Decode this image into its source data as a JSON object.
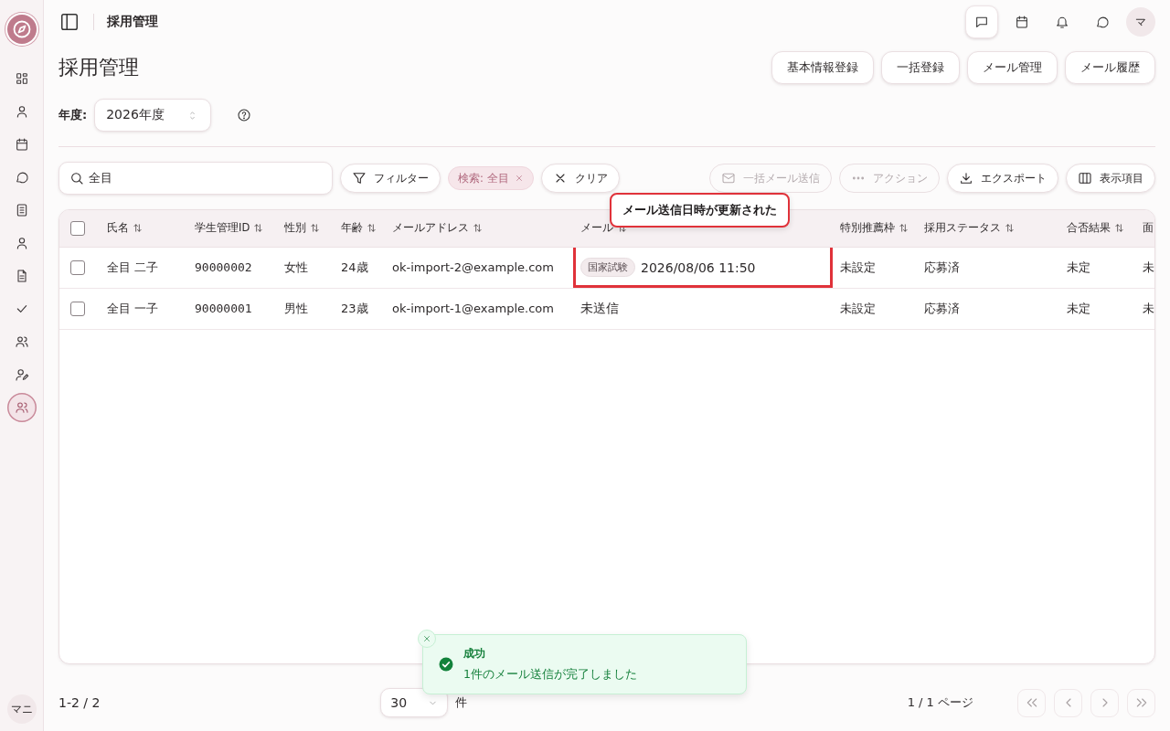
{
  "sidebar": {
    "items": [
      {
        "selected": false
      },
      {
        "selected": false
      },
      {
        "selected": false
      },
      {
        "selected": false
      },
      {
        "selected": false
      },
      {
        "selected": false
      },
      {
        "selected": false
      },
      {
        "selected": false
      },
      {
        "selected": false
      },
      {
        "selected": false
      },
      {
        "selected": true
      }
    ],
    "user_avatar": "マニ"
  },
  "header": {
    "breadcrumb": "採用管理",
    "icons": [
      {
        "selected": true
      },
      {
        "selected": false
      },
      {
        "selected": false
      },
      {
        "selected": false
      }
    ],
    "avatar": "マ"
  },
  "page_title": "採用管理",
  "actions": [
    "基本情報登録",
    "一括登録",
    "メール管理",
    "メール履歴"
  ],
  "year": {
    "label": "年度:",
    "value": "2026年度"
  },
  "search": {
    "value": "全目"
  },
  "filter_button": "フィルター",
  "filter_chip": "検索: 全目",
  "clear_button": "クリア",
  "toolbar": [
    {
      "label": "一括メール送信",
      "disabled": true
    },
    {
      "label": "アクション",
      "disabled": true
    },
    {
      "label": "エクスポート",
      "disabled": false
    },
    {
      "label": "表示項目",
      "disabled": false
    }
  ],
  "table": {
    "select_all_checked": false,
    "columns": [
      {
        "label": "氏名",
        "sortable": true
      },
      {
        "label": "学生管理ID",
        "sortable": true
      },
      {
        "label": "性別",
        "sortable": true
      },
      {
        "label": "年齢",
        "sortable": true
      },
      {
        "label": "メールアドレス",
        "sortable": true
      },
      {
        "label": "メール",
        "sortable": true
      },
      {
        "label": "特別推薦枠",
        "sortable": true
      },
      {
        "label": "採用ステータス",
        "sortable": true
      },
      {
        "label": "合否結果",
        "sortable": true
      },
      {
        "label": "面",
        "sortable": false
      }
    ],
    "rows": [
      {
        "checked": false,
        "name": "全目 二子",
        "student_id": "90000002",
        "gender": "女性",
        "age": "24歳",
        "email": "ok-import-2@example.com",
        "mail_sent": {
          "tag": "国家試験",
          "text": "2026/08/06 11:50",
          "highlighted": true
        },
        "special": "未設定",
        "status": "応募済",
        "result": "未定",
        "column_10": "未"
      },
      {
        "checked": false,
        "name": "全目 一子",
        "student_id": "90000001",
        "gender": "男性",
        "age": "23歳",
        "email": "ok-import-1@example.com",
        "mail_sent": {
          "text": "未送信",
          "highlighted": false
        },
        "special": "未設定",
        "status": "応募済",
        "result": "未定",
        "column_10": "未"
      }
    ]
  },
  "tooltip": "メール送信日時が更新された",
  "pagination": {
    "summary": "1-2 / 2",
    "per_page": "30",
    "unit": "件",
    "page": "1 / 1 ページ",
    "buttons": [
      {
        "kind": "first",
        "disabled": true
      },
      {
        "kind": "prev",
        "disabled": true
      },
      {
        "kind": "next",
        "disabled": true
      },
      {
        "kind": "last",
        "disabled": true
      }
    ]
  },
  "toast": {
    "title": "成功",
    "message": "1件のメール送信が完了しました"
  }
}
